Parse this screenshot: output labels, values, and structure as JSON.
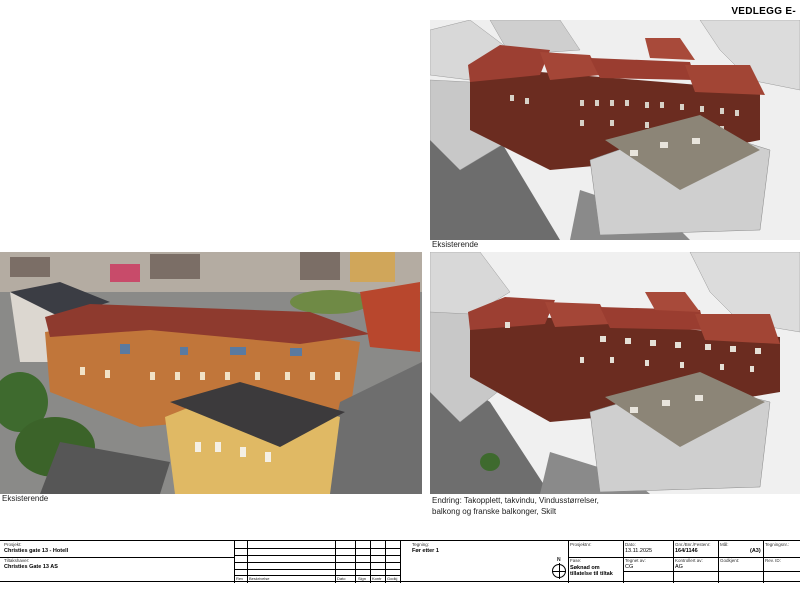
{
  "sheet_tag": "VEDLEGG E-",
  "captions": {
    "model_top": "Eksisterende",
    "photo": "Eksisterende",
    "change": "Endring: Takopplett, takvindu, Vindusstørrelser, balkong og franske balkonger, Skilt"
  },
  "title_block": {
    "prosjekt_label": "Prosjekt:",
    "prosjekt": "Christies gate 13 - Hotell",
    "tiltakshaver_label": "Tiltakshaver:",
    "tiltakshaver": "Christies Gate 13  AS",
    "rev_headers": [
      "Rev",
      "Beskrivelse",
      "Dato",
      "Sign",
      "Kontr",
      "Godkj"
    ],
    "tegning_label": "Tegning:",
    "tegning": "Før etter 1",
    "north": "N",
    "prosjektnr_label": "Prosjektnr:",
    "dato_label": "Dato:",
    "dato": "13.11.2025",
    "gnr_label": "Gnr./Bnr./Festenr:",
    "gnr": "164/1146",
    "maal_label": "Mål:",
    "maal": "(A3)",
    "tegningsnr_label": "Tegningsnr.:",
    "fase_label": "Fase:",
    "fase": "Søknad om tillatelse til tiltak",
    "tegnet_label": "Tegnet av:",
    "tegnet": "CG",
    "kontrollert_label": "Kontrollert av:",
    "kontrollert": "AG",
    "godkjent_label": "Godkjent:",
    "revid_label": "Rev. ID:"
  },
  "colors": {
    "roof_red": "#9c3f32",
    "facade_brick": "#6e2f22",
    "model_grey": "#e4e4e4",
    "photo_facade": "#c77a3c"
  }
}
